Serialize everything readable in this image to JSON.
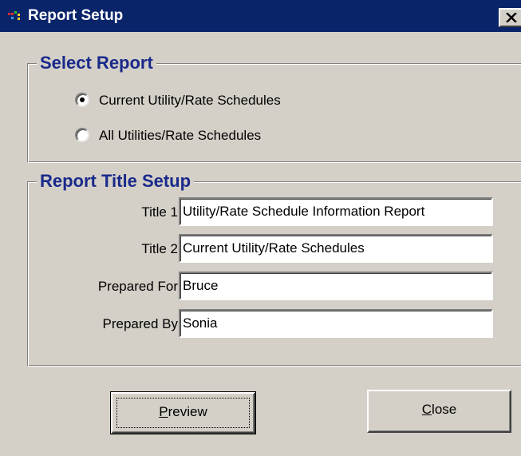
{
  "window": {
    "title": "Report Setup",
    "icon": "app-icon",
    "close_glyph": "✕",
    "colors": {
      "titlebar": "#0a246a",
      "face": "#d4d0c8",
      "legend": "#1a2a8a"
    }
  },
  "select_report": {
    "legend": "Select Report",
    "options": [
      {
        "label": "Current Utility/Rate Schedules",
        "selected": true
      },
      {
        "label": "All Utilities/Rate Schedules",
        "selected": false
      }
    ]
  },
  "title_setup": {
    "legend": "Report Title Setup",
    "fields": [
      {
        "label": "Title 1",
        "value": "Utility/Rate Schedule Information Report"
      },
      {
        "label": "Title 2",
        "value": "Current Utility/Rate Schedules"
      },
      {
        "label": "Prepared For",
        "value": "Bruce"
      },
      {
        "label": "Prepared By",
        "value": "Sonia"
      }
    ]
  },
  "buttons": {
    "preview": {
      "mnemonic": "P",
      "rest": "review"
    },
    "close": {
      "mnemonic": "C",
      "rest": "lose"
    }
  }
}
